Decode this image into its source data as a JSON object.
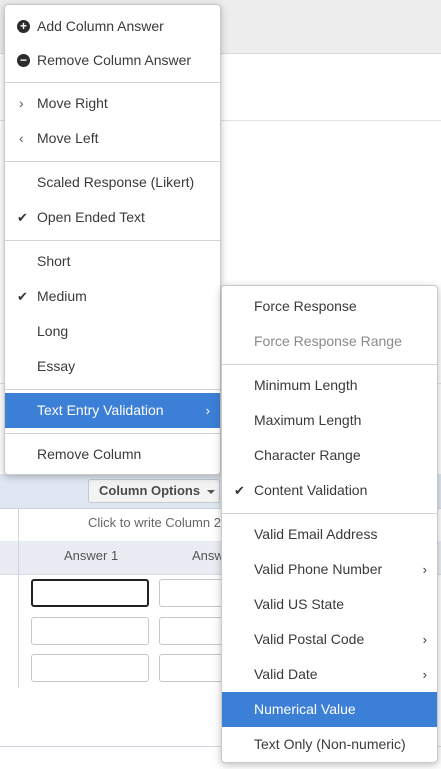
{
  "main_menu": {
    "add_column_answer": "Add Column Answer",
    "remove_column_answer": "Remove Column Answer",
    "move_right": "Move Right",
    "move_left": "Move Left",
    "scaled_response": "Scaled Response (Likert)",
    "open_ended_text": "Open Ended Text",
    "short": "Short",
    "medium": "Medium",
    "long": "Long",
    "essay": "Essay",
    "text_entry_validation": "Text Entry Validation",
    "remove_column": "Remove Column"
  },
  "validation_menu": {
    "force_response": "Force Response",
    "force_response_range": "Force Response Range",
    "minimum_length": "Minimum Length",
    "maximum_length": "Maximum Length",
    "character_range": "Character Range",
    "content_validation": "Content Validation",
    "valid_email": "Valid Email Address",
    "valid_phone": "Valid Phone Number",
    "valid_us_state": "Valid US State",
    "valid_postal": "Valid Postal Code",
    "valid_date": "Valid Date",
    "numerical_value": "Numerical Value",
    "text_only": "Text Only (Non-numeric)"
  },
  "background": {
    "column_options_label": "Column Options",
    "click_to_write": "Click to write Column 2",
    "answer_1": "Answer 1",
    "answer_2": "Answ"
  },
  "colors": {
    "accent": "#3c7fd6",
    "options_row": "#dfe7f2"
  }
}
